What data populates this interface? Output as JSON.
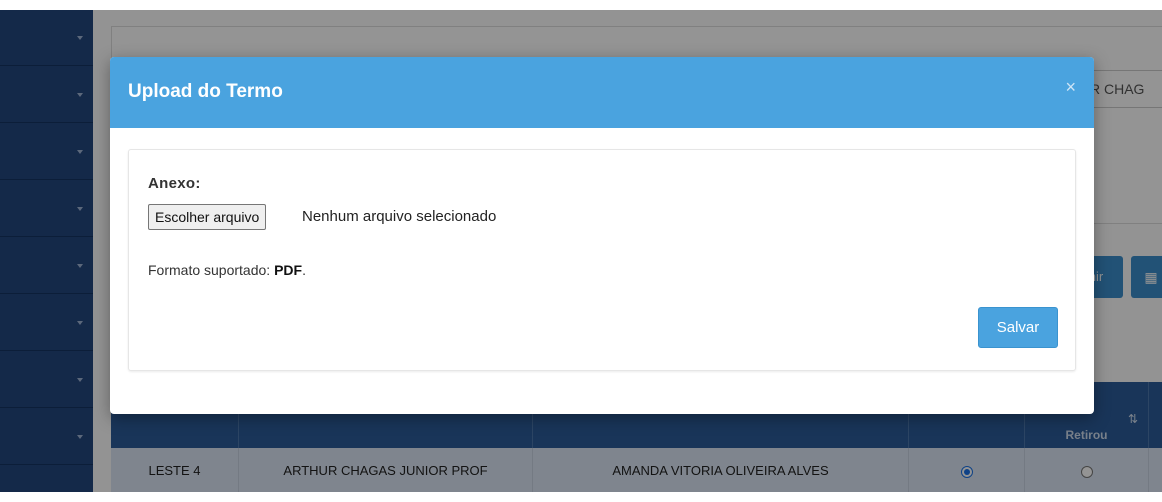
{
  "background": {
    "search_value": "R CHAG",
    "buttons": [
      {
        "label": "nir",
        "icon": ""
      },
      {
        "label": "",
        "icon": "grid-icon"
      }
    ],
    "table": {
      "headers": [
        "",
        "",
        "",
        "",
        "Retirou"
      ],
      "rows": [
        {
          "cells": [
            "LESTE 4",
            "ARTHUR CHAGAS JUNIOR PROF",
            "AMANDA VITORIA OLIVEIRA ALVES"
          ],
          "radio_1_selected": true,
          "radio_2_selected": false
        }
      ]
    }
  },
  "modal": {
    "title": "Upload do Termo",
    "close_icon": "×",
    "anexo_label": "Anexo:",
    "file_button": "Escolher arquivo",
    "file_status": "Nenhum arquivo selecionado",
    "format_prefix": "Formato suportado: ",
    "format_value": "PDF",
    "format_suffix": ".",
    "save_label": "Salvar"
  },
  "colors": {
    "header": "#4aa3df",
    "sidebar": "#24477f",
    "table_header": "#2b5c99"
  }
}
